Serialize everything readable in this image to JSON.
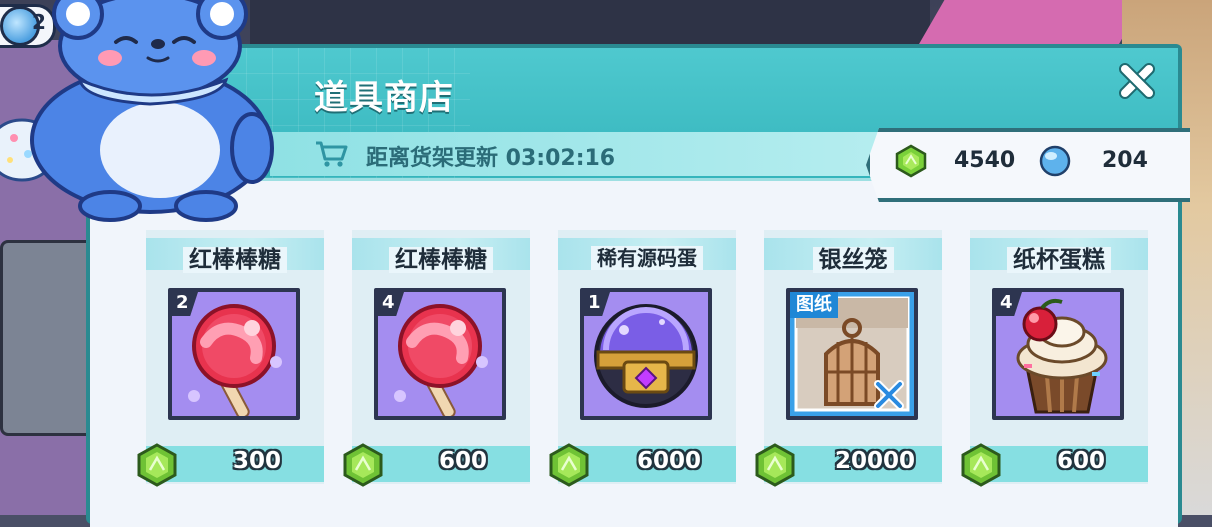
{
  "top_left": {
    "currency_value_partial": "2"
  },
  "shop": {
    "title": "道具商店",
    "timer_label": "距离货架更新 03:02:16",
    "close_label": ""
  },
  "balances": {
    "green_gem": "4540",
    "blue_orb": "204"
  },
  "items": [
    {
      "name": "红棒棒糖",
      "qty": "2",
      "price": "300",
      "icon": "red-lollipop-icon",
      "badge": ""
    },
    {
      "name": "红棒棒糖",
      "qty": "4",
      "price": "600",
      "icon": "red-lollipop-icon",
      "badge": ""
    },
    {
      "name": "稀有源码蛋",
      "qty": "1",
      "price": "6000",
      "icon": "rare-source-egg-icon",
      "badge": ""
    },
    {
      "name": "银丝笼",
      "qty": "",
      "price": "20000",
      "icon": "silver-cage-icon",
      "badge": "图纸"
    },
    {
      "name": "纸杯蛋糕",
      "qty": "4",
      "price": "600",
      "icon": "cupcake-icon",
      "badge": ""
    }
  ],
  "colors": {
    "panel_teal": "#35b5bc",
    "panel_border": "#2a8a91",
    "item_bg_purple": "#a48df0",
    "blueprint_blue": "#3aa0e8",
    "price_bar": "#86dfe2"
  }
}
